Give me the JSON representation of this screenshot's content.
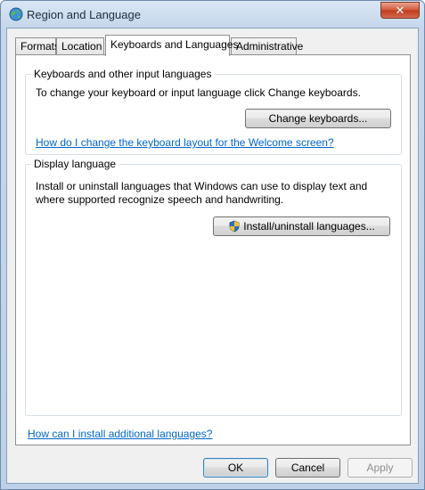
{
  "window": {
    "title": "Region and Language",
    "close_label": "✕"
  },
  "tabs": [
    {
      "label": "Formats"
    },
    {
      "label": "Location"
    },
    {
      "label": "Keyboards and Languages",
      "active": true
    },
    {
      "label": "Administrative"
    }
  ],
  "keyboards_group": {
    "title": "Keyboards and other input languages",
    "description": "To change your keyboard or input language click Change keyboards.",
    "button_label": "Change keyboards...",
    "help_link": "How do I change the keyboard layout for the Welcome screen?"
  },
  "display_group": {
    "title": "Display language",
    "description_line1": "Install or uninstall languages that Windows can use to display text and",
    "description_line2": "where supported recognize speech and handwriting.",
    "button_label": "Install/uninstall languages..."
  },
  "bottom_link": "How can I install additional languages?",
  "footer": {
    "ok_label": "OK",
    "cancel_label": "Cancel",
    "apply_label": "Apply"
  }
}
